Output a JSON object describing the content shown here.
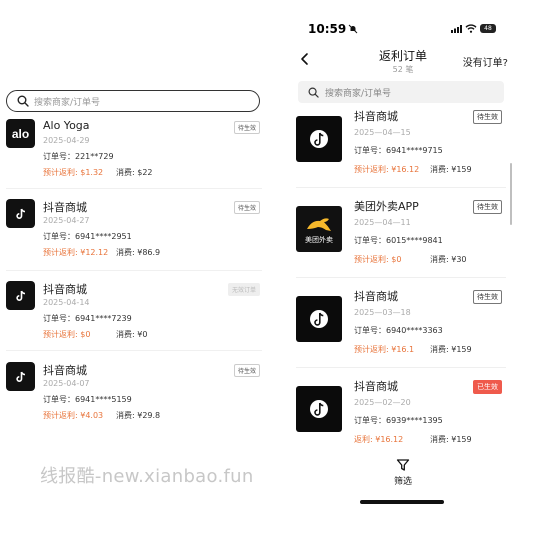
{
  "left": {
    "search_placeholder": "搜索商家/订单号",
    "orders": [
      {
        "merchant": "Alo Yoga",
        "logo_text": "alo",
        "date": "2025-04-29",
        "order_label": "订单号：",
        "order_no": "221**729",
        "rebate": "预计返利: $1.32",
        "spend": "消费: $22",
        "status": "待生效"
      },
      {
        "merchant": "抖音商城",
        "date": "2025-04-27",
        "order_label": "订单号：",
        "order_no": "6941****2951",
        "rebate": "预计返利: ¥12.12",
        "spend": "消费: ¥86.9",
        "status": "待生效"
      },
      {
        "merchant": "抖音商城",
        "date": "2025-04-14",
        "order_label": "订单号：",
        "order_no": "6941****7239",
        "rebate": "预计返利: $0",
        "spend": "消费: ¥0",
        "status": "无效订单"
      },
      {
        "merchant": "抖音商城",
        "date": "2025-04-07",
        "order_label": "订单号：",
        "order_no": "6941****5159",
        "rebate": "预计返利: ¥4.03",
        "spend": "消费: ¥29.8",
        "status": "待生效"
      }
    ],
    "watermark": "线报酷-new.xianbao.fun"
  },
  "right": {
    "status_bar": {
      "time": "10:59",
      "battery": "48"
    },
    "nav": {
      "title": "返利订单",
      "count": "52 笔",
      "no_order_link": "没有订单?"
    },
    "search_placeholder": "搜索商家/订单号",
    "orders": [
      {
        "merchant": "抖音商城",
        "date": "2025—04—15",
        "order_label": "订单号：",
        "order_no": "6941****9715",
        "rebate": "预计返利: ¥16.12",
        "spend": "消费: ¥159",
        "status": "待生效"
      },
      {
        "merchant": "美团外卖APP",
        "logo_text": "美团外卖",
        "date": "2025—04—11",
        "order_label": "订单号：",
        "order_no": "6015****9841",
        "rebate": "预计返利: $0",
        "spend": "消费: ¥30",
        "status": "待生效"
      },
      {
        "merchant": "抖音商城",
        "date": "2025—03—18",
        "order_label": "订单号：",
        "order_no": "6940****3363",
        "rebate": "预计返利: ¥16.1",
        "spend": "消费: ¥159",
        "status": "待生效"
      },
      {
        "merchant": "抖音商城",
        "date": "2025—02—20",
        "order_label": "订单号：",
        "order_no": "6939****1395",
        "rebate": "返利: ¥16.12",
        "spend": "消费: ¥159",
        "status": "已生效"
      }
    ],
    "filter_label": "筛选"
  },
  "colors": {
    "rebate": "#e8743b",
    "done_badge": "#ef5a4c",
    "meituan": "#f7b92b"
  },
  "icons": {
    "search": "search-icon",
    "douyin": "douyin-logo-icon",
    "back": "chevron-left-icon",
    "filter": "funnel-icon"
  }
}
